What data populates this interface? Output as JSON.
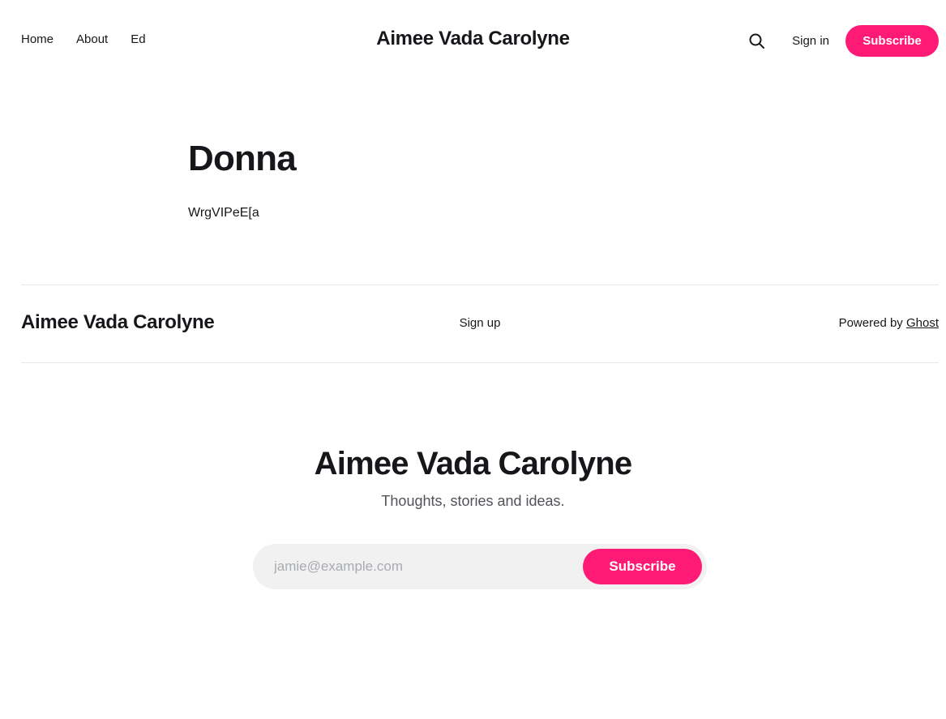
{
  "header": {
    "nav": [
      {
        "label": "Home"
      },
      {
        "label": "About"
      },
      {
        "label": "Ed"
      }
    ],
    "site_title": "Aimee Vada Carolyne",
    "signin_label": "Sign in",
    "subscribe_label": "Subscribe",
    "search_icon": "search-icon"
  },
  "main": {
    "title": "Donna",
    "excerpt": "WrgVIPeE[a"
  },
  "footer": {
    "site_title": "Aimee Vada Carolyne",
    "signup_label": "Sign up",
    "powered_prefix": "Powered by ",
    "powered_link": "Ghost"
  },
  "cta": {
    "title": "Aimee Vada Carolyne",
    "description": "Thoughts, stories and ideas.",
    "email_placeholder": "jamie@example.com",
    "button_label": "Subscribe"
  },
  "colors": {
    "accent": "#ff1a75",
    "text": "#15171a",
    "muted": "#505357",
    "input_bg": "#f1f1f1",
    "divider": "#e8e8e8"
  }
}
